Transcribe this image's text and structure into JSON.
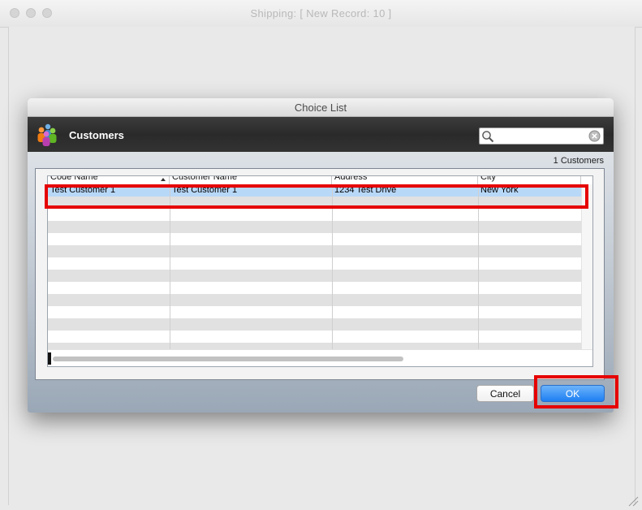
{
  "window": {
    "title": "Shipping:  [ New Record: 10 ]"
  },
  "dialog": {
    "title": "Choice List",
    "header_title": "Customers",
    "search": {
      "value": "",
      "placeholder": ""
    },
    "count_label": "1 Customers",
    "table": {
      "columns": [
        "Code Name",
        "Customer Name",
        "Address",
        "City"
      ],
      "sorted_column": "Code Name",
      "rows": [
        [
          "Test Customer 1",
          "Test Customer 1",
          "1234 Test Drive",
          "New York"
        ]
      ]
    },
    "buttons": {
      "cancel": "Cancel",
      "ok": "OK"
    }
  },
  "colors": {
    "selection_row": "#b8d8f8",
    "stripe_row": "#e1e1e1",
    "annotation": "#e60000",
    "ok_button": "#1e7ff2"
  }
}
